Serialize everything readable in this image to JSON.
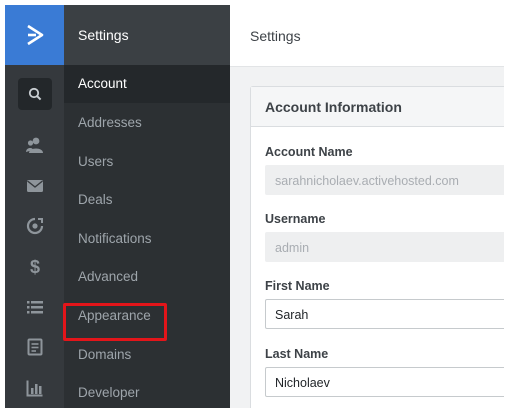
{
  "colors": {
    "brand_blue": "#3a7bd5",
    "rail_background": "#35393d",
    "nav_background": "#2c3033",
    "active_item_background": "#24282b",
    "highlight_red": "#e3151a"
  },
  "rail": {
    "logo_icon": "chevron-right-logo-icon",
    "icons": [
      "search-icon",
      "contacts-icon",
      "mail-icon",
      "automations-icon",
      "dollar-icon",
      "list-icon",
      "document-icon",
      "reports-icon"
    ]
  },
  "nav": {
    "header": "Settings",
    "items": [
      {
        "label": "Account",
        "active": true
      },
      {
        "label": "Addresses",
        "active": false
      },
      {
        "label": "Users",
        "active": false
      },
      {
        "label": "Deals",
        "active": false
      },
      {
        "label": "Notifications",
        "active": false
      },
      {
        "label": "Advanced",
        "active": false
      },
      {
        "label": "Appearance",
        "active": false,
        "highlighted": true
      },
      {
        "label": "Domains",
        "active": false
      },
      {
        "label": "Developer",
        "active": false
      }
    ]
  },
  "main": {
    "header": "Settings",
    "card": {
      "title": "Account Information",
      "fields": [
        {
          "label": "Account Name",
          "value": "sarahnicholaev.activehosted.com",
          "editable": false
        },
        {
          "label": "Username",
          "value": "admin",
          "editable": false
        },
        {
          "label": "First Name",
          "value": "Sarah",
          "editable": true
        },
        {
          "label": "Last Name",
          "value": "Nicholaev",
          "editable": true
        }
      ]
    }
  }
}
